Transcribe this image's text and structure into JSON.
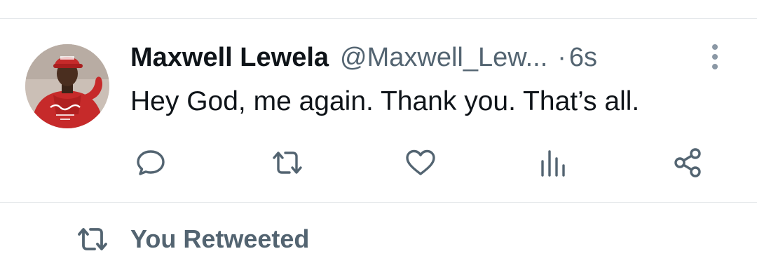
{
  "tweet": {
    "author": {
      "display_name": "Maxwell Lewela",
      "handle": "@Maxwell_Lew...",
      "avatar_icon": "profile-photo-red-cap-shirt"
    },
    "separator": "·",
    "timestamp": "6s",
    "text": "Hey God, me again. Thank you. That’s all.",
    "actions": [
      {
        "name": "reply",
        "icon": "comment-bubble-icon"
      },
      {
        "name": "retweet",
        "icon": "retweet-icon"
      },
      {
        "name": "like",
        "icon": "heart-icon"
      },
      {
        "name": "views",
        "icon": "bar-chart-icon"
      },
      {
        "name": "share",
        "icon": "share-icon"
      }
    ]
  },
  "next_item": {
    "social_context": "You Retweeted",
    "icon": "retweet-icon"
  },
  "colors": {
    "primary_text": "#0f1419",
    "secondary_text": "#536471",
    "divider": "#e4e7ea",
    "more_dots": "#8b98a5"
  }
}
